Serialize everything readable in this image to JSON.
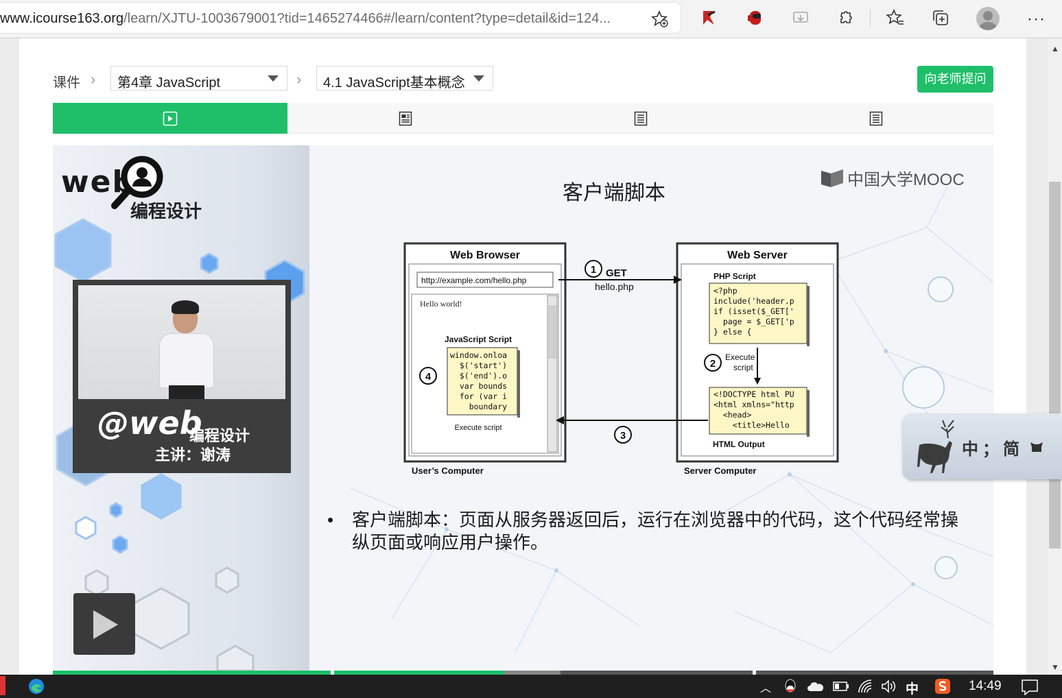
{
  "browser": {
    "url_host": "www.icourse163.org",
    "url_path": "/learn/XJTU-1003679001?tid=1465274466#/learn/content?type=detail&id=124..."
  },
  "breadcrumb": {
    "label": "课件",
    "chapter": "第4章 JavaScript",
    "section": "4.1 JavaScript基本概念"
  },
  "ask_button": "向老师提问",
  "tabs": [
    "video-icon",
    "doc-icon",
    "text-icon",
    "text-icon"
  ],
  "video": {
    "brand": "web",
    "brand_cn": "编程设计",
    "cam_brand": "@web",
    "cam_brand_cn": "编程设计",
    "teacher": "主讲：谢涛",
    "slide_title": "客户端脚本",
    "mooc_logo": "中国大学MOOC",
    "bullet": "客户端脚本：页面从服务器返回后，运行在浏览器中的代码，这个代码经常操纵页面或响应用户操作。",
    "diagram": {
      "browser_title": "Web Browser",
      "browser_url": "http://example.com/hello.php",
      "hello": "Hello world!",
      "js_label": "JavaScript Script",
      "js_code": [
        "window.onloa",
        "  $('start')",
        "  $('end').o",
        "  var bounds",
        "  for (var i",
        "    boundary"
      ],
      "execute_script_client": "Execute script",
      "users_computer": "User’s Computer",
      "step1": "1",
      "step1_get": "GET",
      "step1_file": "hello.php",
      "step2": "2",
      "step2_label1": "Execute",
      "step2_label2": "script",
      "step3": "3",
      "step4": "4",
      "server_title": "Web Server",
      "php_label": "PHP Script",
      "php_code": [
        "<?php",
        "include('header.p",
        "if (isset($_GET['",
        "  page = $_GET['p",
        "} else {"
      ],
      "html_code": [
        "<!DOCTYPE html PU",
        "<html xmlns=\"http",
        "  <head>",
        "    <title>Hello"
      ],
      "html_output": "HTML Output",
      "server_computer": "Server Computer"
    },
    "progress": {
      "played": 0.48,
      "buffered": 0.54
    }
  },
  "ime": {
    "mode": "中",
    "punct": "；",
    "script": "简"
  },
  "taskbar": {
    "ime": "中",
    "time": "14:49"
  },
  "colors": {
    "accent": "#1fbf6a",
    "taskbar": "#1f1f1f"
  }
}
